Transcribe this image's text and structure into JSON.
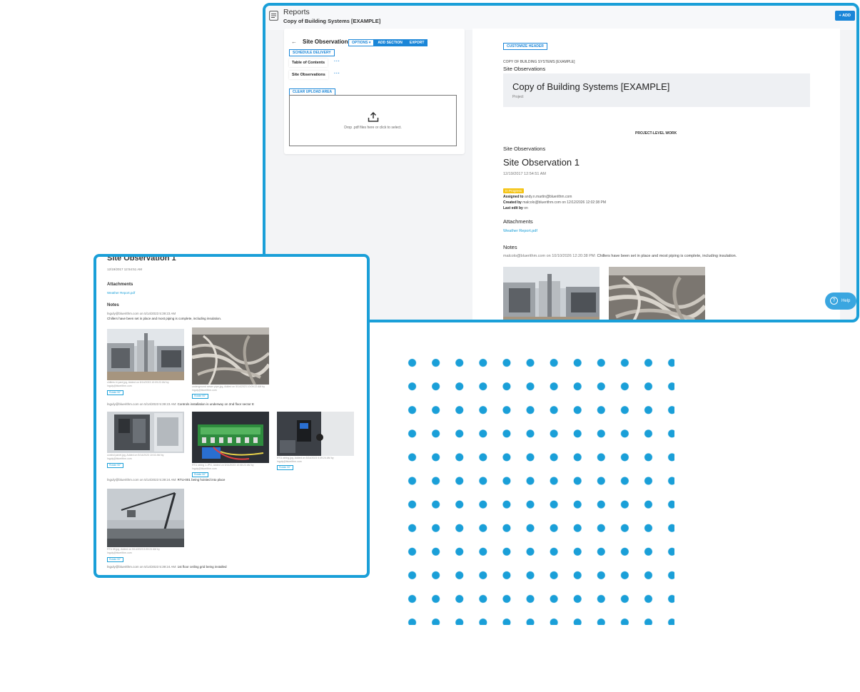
{
  "header": {
    "app_title": "Reports",
    "report_name": "Copy of Building Systems [EXAMPLE]",
    "add_label": "+ ADD"
  },
  "sidebar": {
    "title": "Site Observations",
    "options_label": "OPTIONS ▾",
    "add_section_label": "ADD SECTION",
    "export_label": "EXPORT",
    "schedule_label": "SCHEDULE DELIVERY",
    "items": [
      {
        "label": "Table of Contents"
      },
      {
        "label": "Site Observations"
      }
    ],
    "clear_label": "CLEAR UPLOAD AREA",
    "upload_text": "Drop .pdf files here or click to select."
  },
  "document": {
    "customize_label": "CUSTOMIZE HEADER",
    "copy_label": "COPY OF BUILDING SYSTEMS [EXAMPLE]",
    "section_label": "Site Observations",
    "banner_title": "Copy of Building Systems [EXAMPLE]",
    "banner_sub": "Project",
    "project_level": "PROJECT-LEVEL WORK",
    "section_label_2": "Site Observations",
    "obs_title": "Site Observation 1",
    "obs_date": "12/19/2017 12:54:51 AM",
    "status": "In Progress",
    "assigned_key": "Assigned to",
    "assigned_val": "andy.n.martin@bluerithm.com",
    "created_key": "Created by",
    "created_val": "malcolo@bluerithm.com on 12/12/2026 12:02:38 PM",
    "lastedit_key": "Last edit by",
    "lastedit_val": "on",
    "attachments_heading": "Attachments",
    "attachment_link": "Weather Report.pdf",
    "notes_heading": "Notes",
    "notes_author": "malcolo@bluerithm.com on 10/10/2026 12:20:38 PM:",
    "notes_text": "Chillers have been set in place and most piping is complete, including insulation.",
    "help_label": "Help"
  },
  "preview": {
    "title": "Site Observation 1",
    "date": "12/19/2017 12:54:51 AM",
    "attachments_heading": "Attachments",
    "attachment_link": "Weather Report.pdf",
    "notes_heading": "Notes",
    "note1_author": "lnguly@bluerithm.com on 5/14/2023 5:39:23 AM",
    "note1_text": "Chillers have been set in place and most piping is complete, including insulation.",
    "caption1": "chillers in yard.jpg, Added on 5/14/2023 10:09:22 AM by",
    "caption1b": "lnguly@bluerithm.com",
    "caption2": "underground sewer pipe.jpg, Added on 5/14/2023 10:09:22 AM by",
    "caption2b": "lnguly@bluerithm.com",
    "rotate_label": "Rotate 90°",
    "note2_author": "lnguly@bluerithm.com on 5/14/2023 5:39:23 AM:",
    "note2_text": "Controls installation is underway on 2nd floor sector E",
    "caption3": "control panel.jpg, Added on 5/14/2023 10:02 AM by",
    "caption3b": "lnguly@bluerithm.com",
    "caption4": "RTU wiring 1.JPG, Added on 5/14/2023 10:08:22 AM by",
    "caption4b": "lnguly@bluerithm.com",
    "caption5": "RTU wiring.jpg, Added on 5/14/2023 5:39:24 AM by",
    "caption5b": "lnguly@bluerithm.com",
    "note3_author": "lnguly@bluerithm.com on 5/14/2023 5:39:24 AM:",
    "note3_text": "RTU-001 being hoisted into place",
    "caption6": "RTU lift.jpg, Added on 5/14/2023 5:39:24 AM by",
    "caption6b": "lnguly@bluerithm.com",
    "note4_author": "lnguly@bluerithm.com on 5/14/2023 5:39:24 AM:",
    "note4_text": "1st floor ceiling grid being installed"
  }
}
